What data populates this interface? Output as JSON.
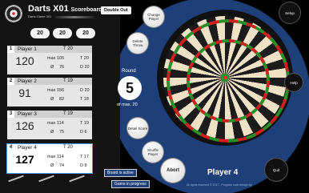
{
  "header": {
    "title_main": "Darts X01",
    "title_rest": "Scoreboard",
    "subtitle": "Darts Game 301",
    "double_out": "Double Out"
  },
  "pills": [
    "20",
    "20",
    "20"
  ],
  "players": [
    {
      "num": "1",
      "name": "Player 1",
      "left_label": "T 20",
      "score": "120",
      "max_label": "max",
      "max": "105",
      "max_right": "T 20",
      "avg_label": "Ø",
      "avg": "76",
      "last_right": "D 20"
    },
    {
      "num": "2",
      "name": "Player 2",
      "left_label": "T 19",
      "score": "91",
      "max_label": "max",
      "max": "156",
      "max_right": "D 20",
      "avg_label": "Ø",
      "avg": "82",
      "last_right": "T 18"
    },
    {
      "num": "3",
      "name": "Player 3",
      "left_label": "T 19",
      "score": "126",
      "max_label": "max",
      "max": "114",
      "max_right": "T 19",
      "avg_label": "Ø",
      "avg": "75",
      "last_right": "D 6"
    },
    {
      "num": "4",
      "name": "Player 4",
      "left_label": "T 20",
      "score": "127",
      "max_label": "max",
      "max": "114",
      "max_right": "T 17",
      "avg_label": "Ø",
      "avg": "74",
      "last_right": "D 8"
    }
  ],
  "round": {
    "label": "Round",
    "value": "5",
    "max_text": "of max. 20"
  },
  "buttons": {
    "change_player": "Change Player",
    "delete_throw": "Delete Throw",
    "setup": "Setup",
    "help": "Help",
    "detail_score": "Detail Score",
    "shuffle_player": "Shuffle Player",
    "abort": "Abort",
    "quit": "Quit"
  },
  "current_player": "Player 4",
  "status": {
    "board_active": "Board is active",
    "game_in_progress": "Game in progress"
  },
  "copyright": "All rights reserved © 2017 - Program code design by"
}
